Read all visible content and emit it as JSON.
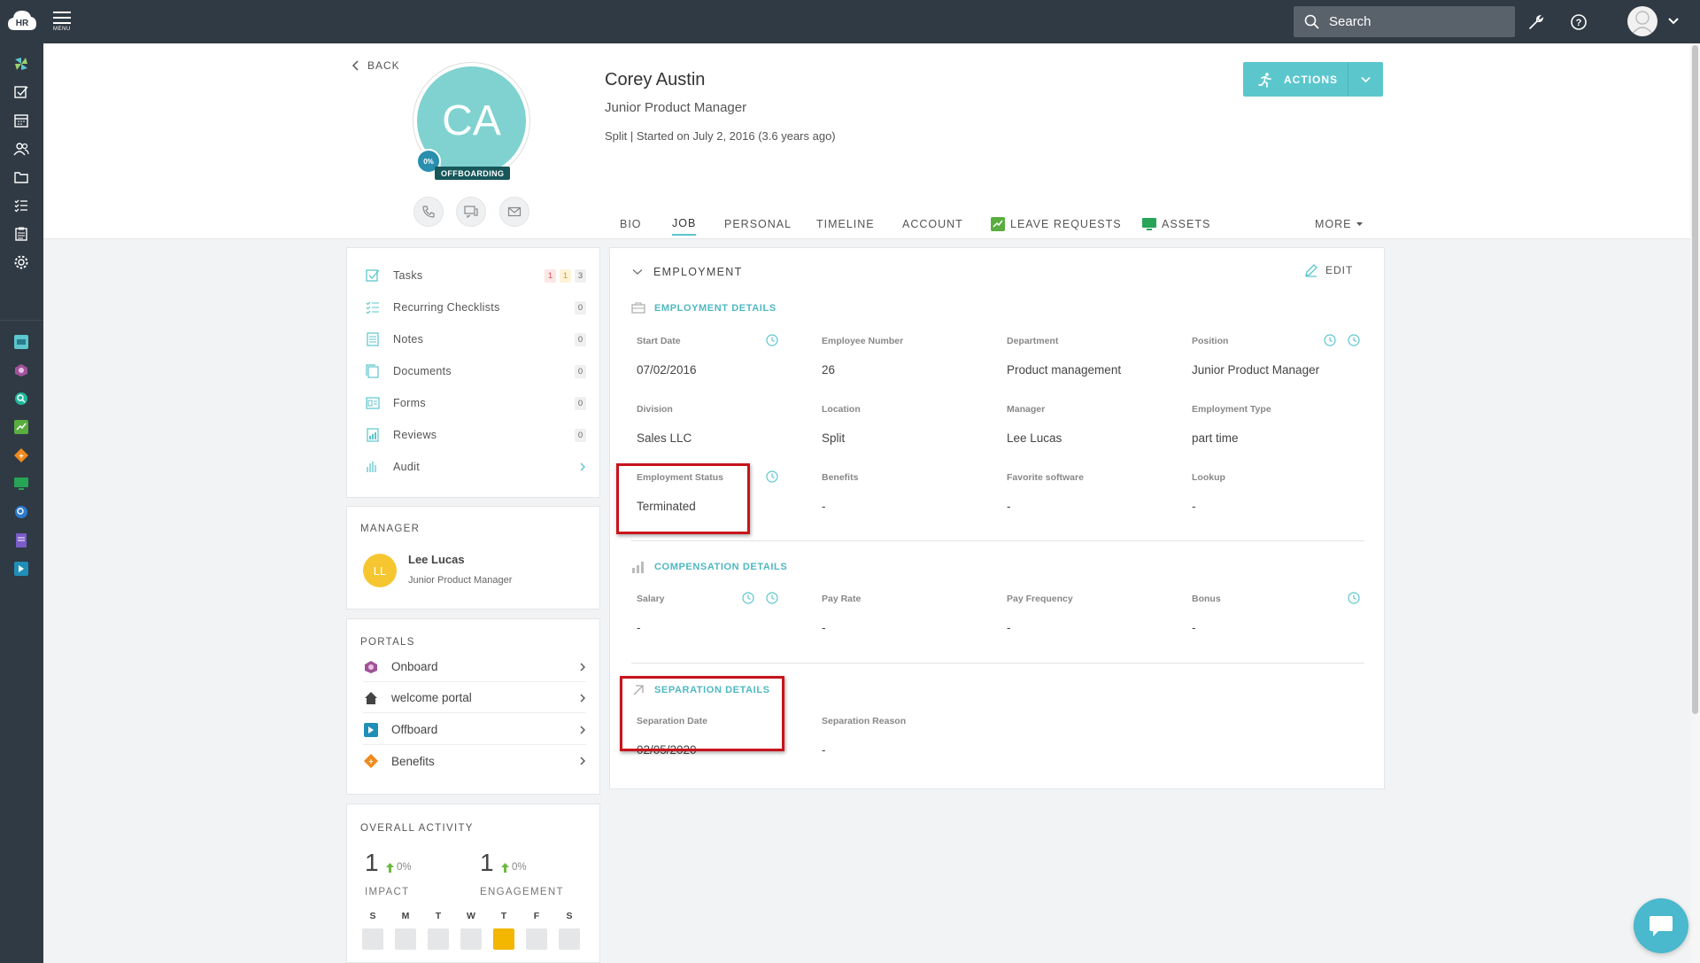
{
  "topbar": {
    "logo_text": "HR",
    "menu_label": "MENU",
    "search_placeholder": "Search"
  },
  "profile": {
    "back_label": "BACK",
    "initials": "CA",
    "progress": "0%",
    "status": "OFFBOARDING",
    "name": "Corey Austin",
    "title": "Junior Product Manager",
    "meta": "Split | Started on July 2, 2016 (3.6 years ago)",
    "actions_label": "ACTIONS"
  },
  "tabs": [
    {
      "label": "BIO"
    },
    {
      "label": "JOB"
    },
    {
      "label": "PERSONAL"
    },
    {
      "label": "TIMELINE"
    },
    {
      "label": "ACCOUNT"
    },
    {
      "label": "LEAVE REQUESTS"
    },
    {
      "label": "ASSETS"
    }
  ],
  "tab_more": "MORE",
  "links": [
    {
      "label": "Tasks",
      "counts": [
        "1",
        "1",
        "3"
      ]
    },
    {
      "label": "Recurring Checklists",
      "count": "0"
    },
    {
      "label": "Notes",
      "count": "0"
    },
    {
      "label": "Documents",
      "count": "0"
    },
    {
      "label": "Forms",
      "count": "0"
    },
    {
      "label": "Reviews",
      "count": "0"
    },
    {
      "label": "Audit"
    }
  ],
  "manager": {
    "heading": "MANAGER",
    "initials": "LL",
    "name": "Lee Lucas",
    "title": "Junior Product Manager"
  },
  "portals": {
    "heading": "PORTALS",
    "items": [
      {
        "label": "Onboard"
      },
      {
        "label": "welcome portal"
      },
      {
        "label": "Offboard"
      },
      {
        "label": "Benefits"
      }
    ]
  },
  "activity": {
    "heading": "OVERALL ACTIVITY",
    "impact_value": "1",
    "impact_pct": "0%",
    "impact_label": "IMPACT",
    "engagement_value": "1",
    "engagement_pct": "0%",
    "engagement_label": "ENGAGEMENT",
    "days": [
      "S",
      "M",
      "T",
      "W",
      "T",
      "F",
      "S"
    ],
    "active_day_index": 4,
    "active_color": "#f3b700"
  },
  "employment": {
    "heading": "EMPLOYMENT",
    "edit_label": "EDIT",
    "details_heading": "EMPLOYMENT DETAILS",
    "fields": {
      "start_date_label": "Start Date",
      "start_date": "07/02/2016",
      "employee_number_label": "Employee Number",
      "employee_number": "26",
      "department_label": "Department",
      "department": "Product management",
      "position_label": "Position",
      "position": "Junior Product Manager",
      "division_label": "Division",
      "division": "Sales LLC",
      "location_label": "Location",
      "location": "Split",
      "manager_label": "Manager",
      "manager": "Lee Lucas",
      "employment_type_label": "Employment Type",
      "employment_type": "part time",
      "employment_status_label": "Employment Status",
      "employment_status": "Terminated",
      "benefits_label": "Benefits",
      "benefits": "-",
      "favorite_software_label": "Favorite software",
      "favorite_software": "-",
      "lookup_label": "Lookup",
      "lookup": "-"
    },
    "compensation_heading": "COMPENSATION DETAILS",
    "compensation": {
      "salary_label": "Salary",
      "salary": "-",
      "pay_rate_label": "Pay Rate",
      "pay_rate": "-",
      "pay_frequency_label": "Pay Frequency",
      "pay_frequency": "-",
      "bonus_label": "Bonus",
      "bonus": "-"
    },
    "separation_heading": "SEPARATION DETAILS",
    "separation": {
      "date_label": "Separation Date",
      "date": "02/05/2020",
      "reason_label": "Separation Reason",
      "reason": "-"
    }
  },
  "colors": {
    "accent": "#5cc6cd",
    "topbar": "#303a44",
    "highlight_box": "#c8141c"
  }
}
